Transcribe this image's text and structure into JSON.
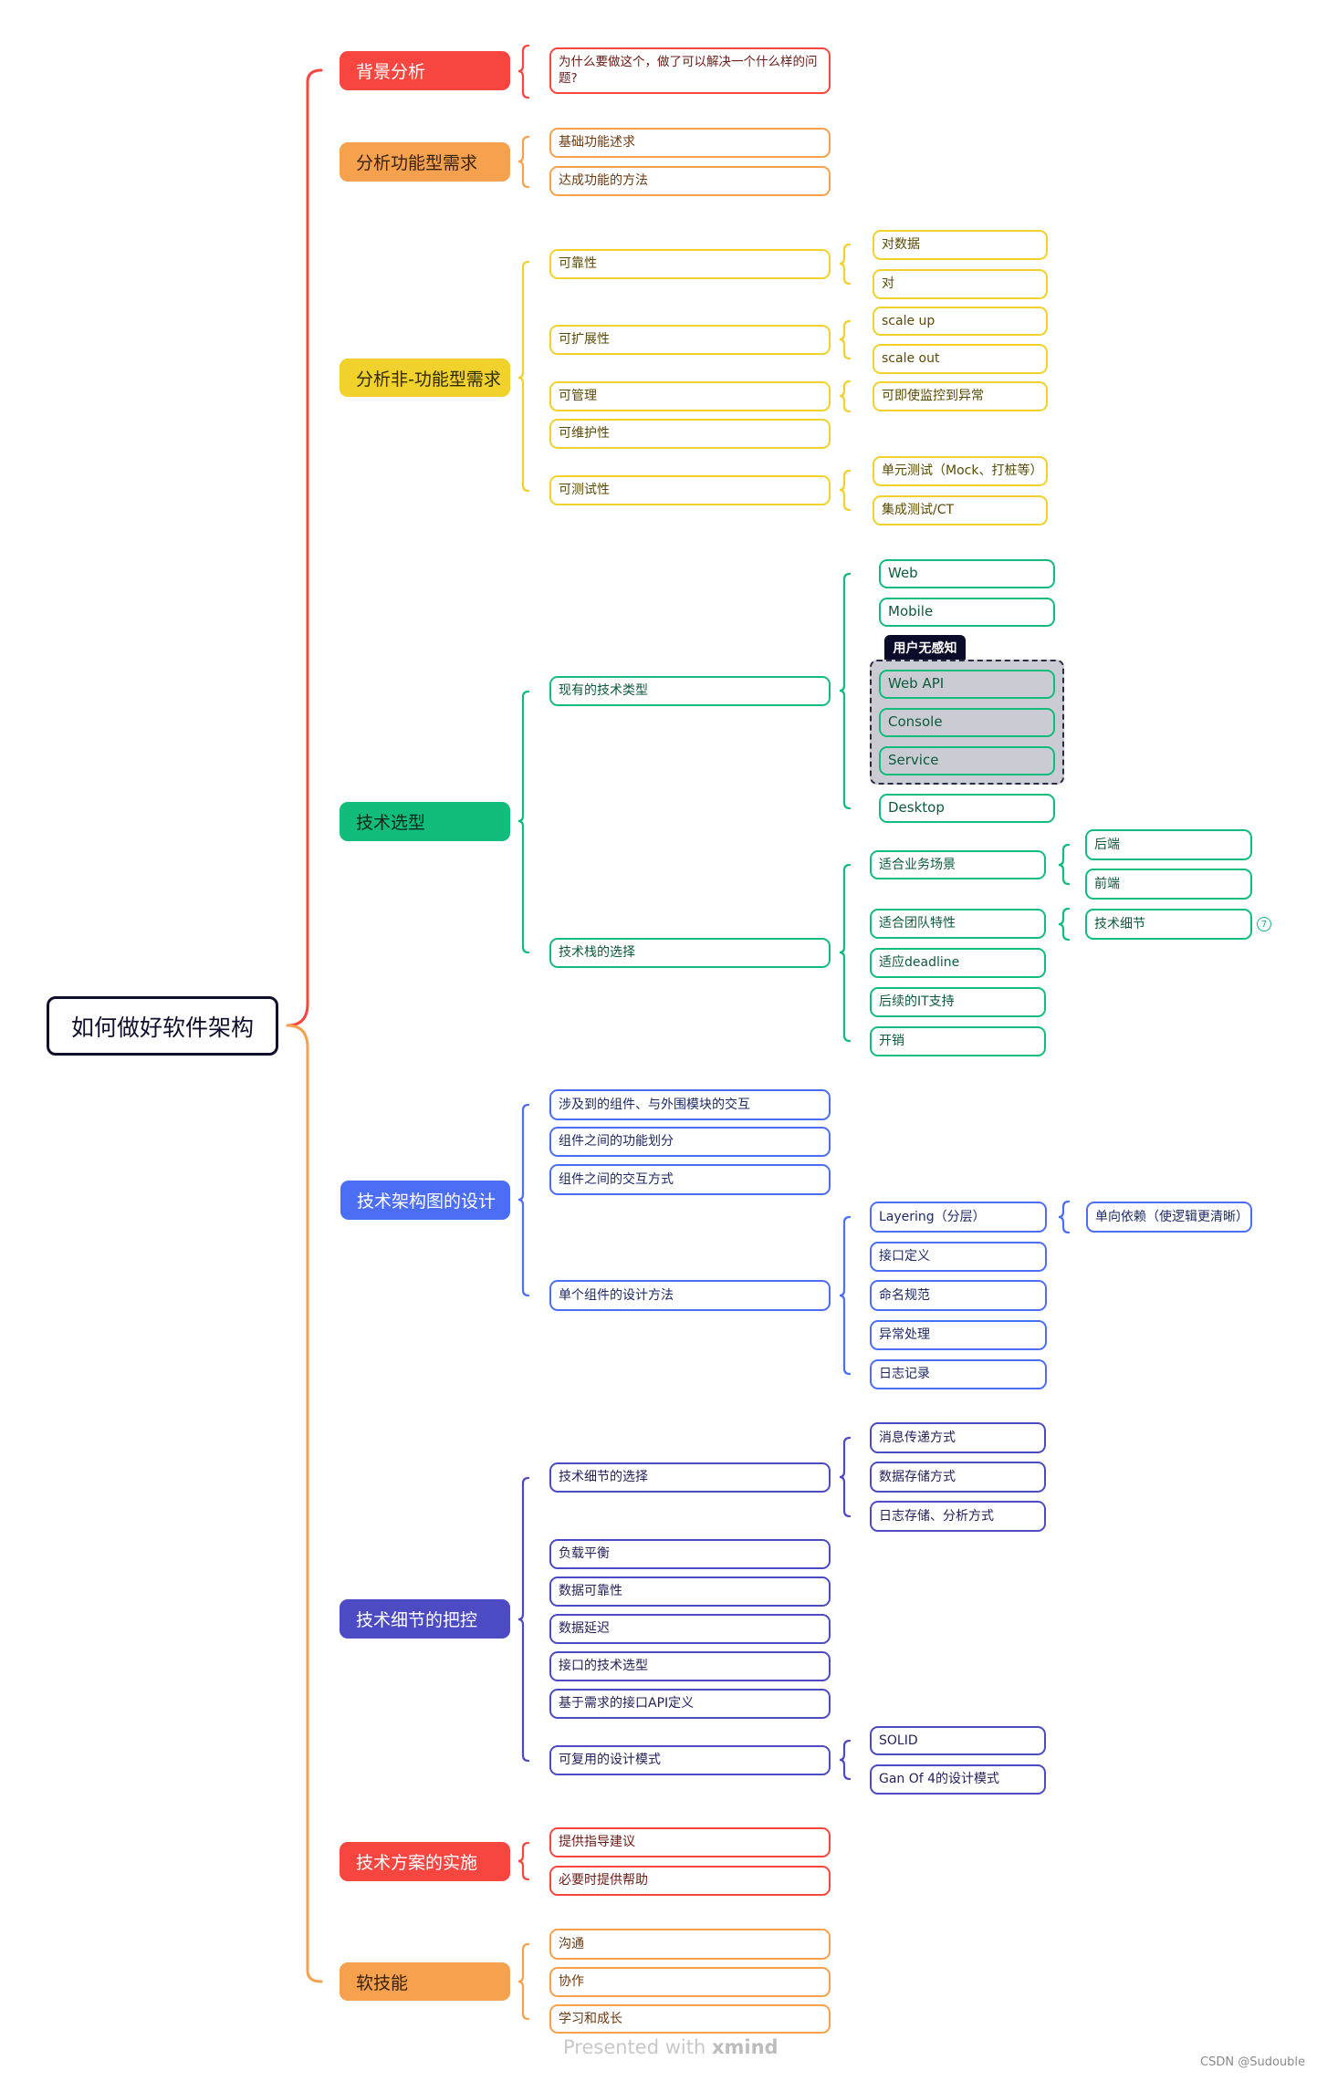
{
  "root": {
    "label": "如何做好软件架构"
  },
  "colors": {
    "red": "#f74640",
    "orange": "#f5a14d",
    "yellow": "#f1d12c",
    "green": "#12bc7b",
    "blue": "#4c6ef5",
    "indigo": "#4c4bc4",
    "root_border": "#0f0f2e"
  },
  "branches": [
    {
      "label": "背景分析",
      "color": "red",
      "children": [
        {
          "label": "为什么要做这个，做了可以解决一个什么样的问题?"
        }
      ]
    },
    {
      "label": "分析功能型需求",
      "color": "orange",
      "children": [
        {
          "label": "基础功能述求"
        },
        {
          "label": "达成功能的方法"
        }
      ]
    },
    {
      "label": "分析非-功能型需求",
      "color": "yellow",
      "children": [
        {
          "label": "可靠性",
          "children": [
            {
              "label": "对数据"
            },
            {
              "label": "对"
            }
          ]
        },
        {
          "label": "可扩展性",
          "children": [
            {
              "label": "scale up"
            },
            {
              "label": "scale out"
            }
          ]
        },
        {
          "label": "可管理",
          "children": [
            {
              "label": "可即使监控到异常"
            }
          ]
        },
        {
          "label": "可维护性"
        },
        {
          "label": "可测试性",
          "children": [
            {
              "label": "单元测试（Mock、打桩等）"
            },
            {
              "label": "集成测试/CT"
            }
          ]
        }
      ]
    },
    {
      "label": "技术选型",
      "color": "green",
      "children": [
        {
          "label": "现有的技术类型",
          "children": [
            {
              "label": "Web"
            },
            {
              "label": "Mobile"
            },
            {
              "label": "Web API"
            },
            {
              "label": "Console"
            },
            {
              "label": "Service"
            },
            {
              "label": "Desktop"
            }
          ],
          "boundary": {
            "label": "用户无感知",
            "members": [
              "Web API",
              "Console",
              "Service"
            ]
          }
        },
        {
          "label": "技术栈的选择",
          "children": [
            {
              "label": "适合业务场景",
              "children": [
                {
                  "label": "后端"
                },
                {
                  "label": "前端"
                }
              ]
            },
            {
              "label": "适合团队特性",
              "children": [
                {
                  "label": "技术细节",
                  "badge": "7"
                }
              ]
            },
            {
              "label": "适应deadline"
            },
            {
              "label": "后续的IT支持"
            },
            {
              "label": "开销"
            }
          ]
        }
      ]
    },
    {
      "label": "技术架构图的设计",
      "color": "blue",
      "children": [
        {
          "label": "涉及到的组件、与外围模块的交互"
        },
        {
          "label": "组件之间的功能划分"
        },
        {
          "label": "组件之间的交互方式"
        },
        {
          "label": "单个组件的设计方法",
          "children": [
            {
              "label": "Layering（分层）",
              "children": [
                {
                  "label": "单向依赖（使逻辑更清晰）"
                }
              ]
            },
            {
              "label": "接口定义"
            },
            {
              "label": "命名规范"
            },
            {
              "label": "异常处理"
            },
            {
              "label": "日志记录"
            }
          ]
        }
      ]
    },
    {
      "label": "技术细节的把控",
      "color": "indigo",
      "children": [
        {
          "label": "技术细节的选择",
          "children": [
            {
              "label": "消息传递方式"
            },
            {
              "label": "数据存储方式"
            },
            {
              "label": "日志存储、分析方式"
            }
          ]
        },
        {
          "label": "负载平衡"
        },
        {
          "label": "数据可靠性"
        },
        {
          "label": "数据延迟"
        },
        {
          "label": "接口的技术选型"
        },
        {
          "label": "基于需求的接口API定义"
        },
        {
          "label": "可复用的设计模式",
          "children": [
            {
              "label": "SOLID"
            },
            {
              "label": "Gan Of 4的设计模式"
            }
          ]
        }
      ]
    },
    {
      "label": "技术方案的实施",
      "color": "red",
      "children": [
        {
          "label": "提供指导建议"
        },
        {
          "label": "必要时提供帮助"
        }
      ]
    },
    {
      "label": "软技能",
      "color": "orange",
      "children": [
        {
          "label": "沟通"
        },
        {
          "label": "协作"
        },
        {
          "label": "学习和成长"
        }
      ]
    }
  ],
  "footer": {
    "prefix": "Presented with ",
    "brand": "xmind"
  },
  "watermark": "CSDN @Sudouble"
}
